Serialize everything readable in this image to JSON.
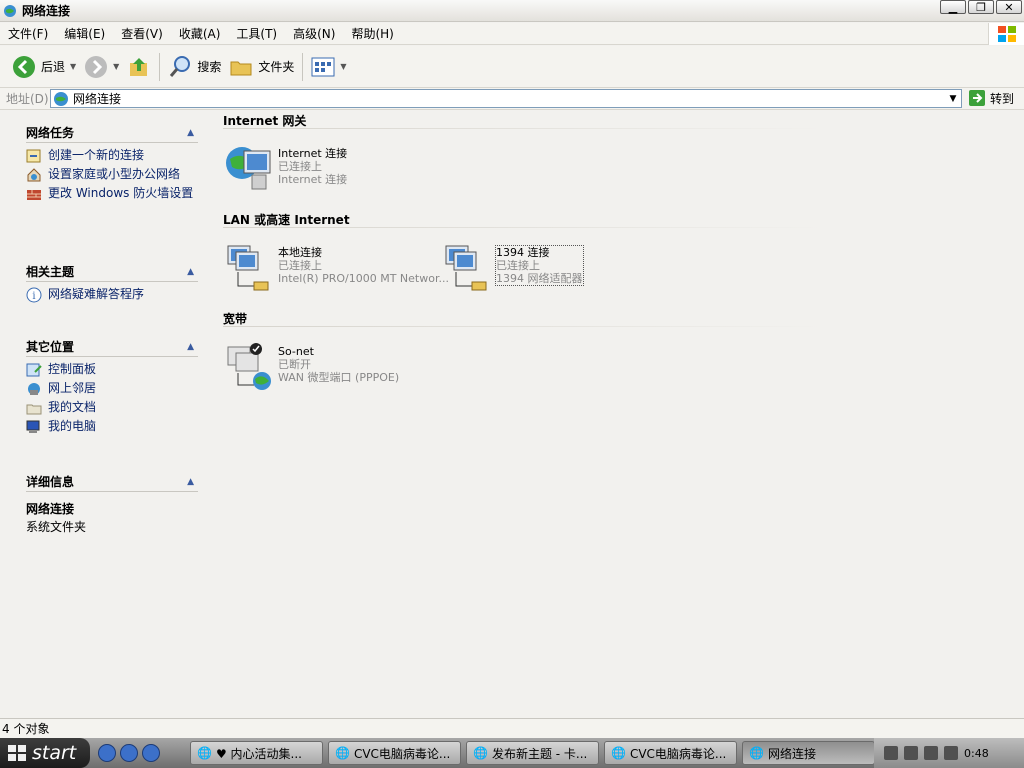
{
  "window": {
    "title": "网络连接"
  },
  "menu": [
    "文件(F)",
    "编辑(E)",
    "查看(V)",
    "收藏(A)",
    "工具(T)",
    "高级(N)",
    "帮助(H)"
  ],
  "toolbar": {
    "back": "后退",
    "search": "搜索",
    "folders": "文件夹"
  },
  "address": {
    "label": "地址(D)",
    "value": "网络连接",
    "go": "转到"
  },
  "sidebar": {
    "network_tasks": {
      "title": "网络任务",
      "items": [
        "创建一个新的连接",
        "设置家庭或小型办公网络",
        "更改 Windows 防火墙设置"
      ]
    },
    "related": {
      "title": "相关主题",
      "items": [
        "网络疑难解答程序"
      ]
    },
    "other": {
      "title": "其它位置",
      "items": [
        "控制面板",
        "网上邻居",
        "我的文档",
        "我的电脑"
      ]
    },
    "details": {
      "title": "详细信息",
      "name": "网络连接",
      "type": "系统文件夹"
    }
  },
  "groups": [
    {
      "title": "Internet 网关",
      "items": [
        {
          "name": "Internet 连接",
          "status": "已连接上",
          "device": "Internet 连接"
        }
      ]
    },
    {
      "title": "LAN 或高速 Internet",
      "items": [
        {
          "name": "本地连接",
          "status": "已连接上",
          "device": "Intel(R) PRO/1000 MT Networ..."
        },
        {
          "name": "1394 连接",
          "status": "已连接上",
          "device": "1394 网络适配器"
        }
      ]
    },
    {
      "title": "宽带",
      "items": [
        {
          "name": "So-net",
          "status": "已断开",
          "device": "WAN 微型端口 (PPPOE)"
        }
      ]
    }
  ],
  "status": {
    "text": "4 个对象"
  },
  "taskbar": {
    "start": "start",
    "tasks": [
      "♥ 内心活动集...",
      "CVC电脑病毒论...",
      "发布新主题 - 卡...",
      "CVC电脑病毒论...",
      "网络连接"
    ],
    "clock": "0:48"
  },
  "colors": {
    "title_bg": "#f3f2ef",
    "link": "#0a246a",
    "taskbar": "#8a8a8a"
  }
}
